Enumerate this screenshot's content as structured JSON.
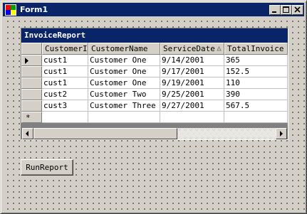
{
  "window": {
    "title": "Form1",
    "controls": {
      "minimize_icon": "minimize-icon",
      "maximize_icon": "maximize-icon",
      "close_icon": "close-icon"
    }
  },
  "grid": {
    "caption": "InvoiceReport",
    "columns": [
      "CustomerID",
      "CustomerName",
      "ServiceDate",
      "TotalInvoice"
    ],
    "sorted_column": "ServiceDate",
    "rows": [
      {
        "CustomerID": "cust1",
        "CustomerName": "Customer One",
        "ServiceDate": "9/14/2001",
        "TotalInvoice": "365"
      },
      {
        "CustomerID": "cust1",
        "CustomerName": "Customer One",
        "ServiceDate": "9/17/2001",
        "TotalInvoice": "152.5"
      },
      {
        "CustomerID": "cust1",
        "CustomerName": "Customer One",
        "ServiceDate": "9/19/2001",
        "TotalInvoice": "110"
      },
      {
        "CustomerID": "cust2",
        "CustomerName": "Customer Two",
        "ServiceDate": "9/25/2001",
        "TotalInvoice": "390"
      },
      {
        "CustomerID": "cust3",
        "CustomerName": "Customer Three",
        "ServiceDate": "9/27/2001",
        "TotalInvoice": "567.5"
      }
    ],
    "current_row_indicator": "row-pointer-icon",
    "new_row_marker": "*",
    "scrollbar": {
      "left_icon": "scroll-left-icon",
      "right_icon": "scroll-right-icon"
    }
  },
  "run_button": {
    "label": "RunReport"
  },
  "colors": {
    "titlebar": "#0a246a",
    "face": "#d4d0c8",
    "grid_background": "#808080"
  }
}
